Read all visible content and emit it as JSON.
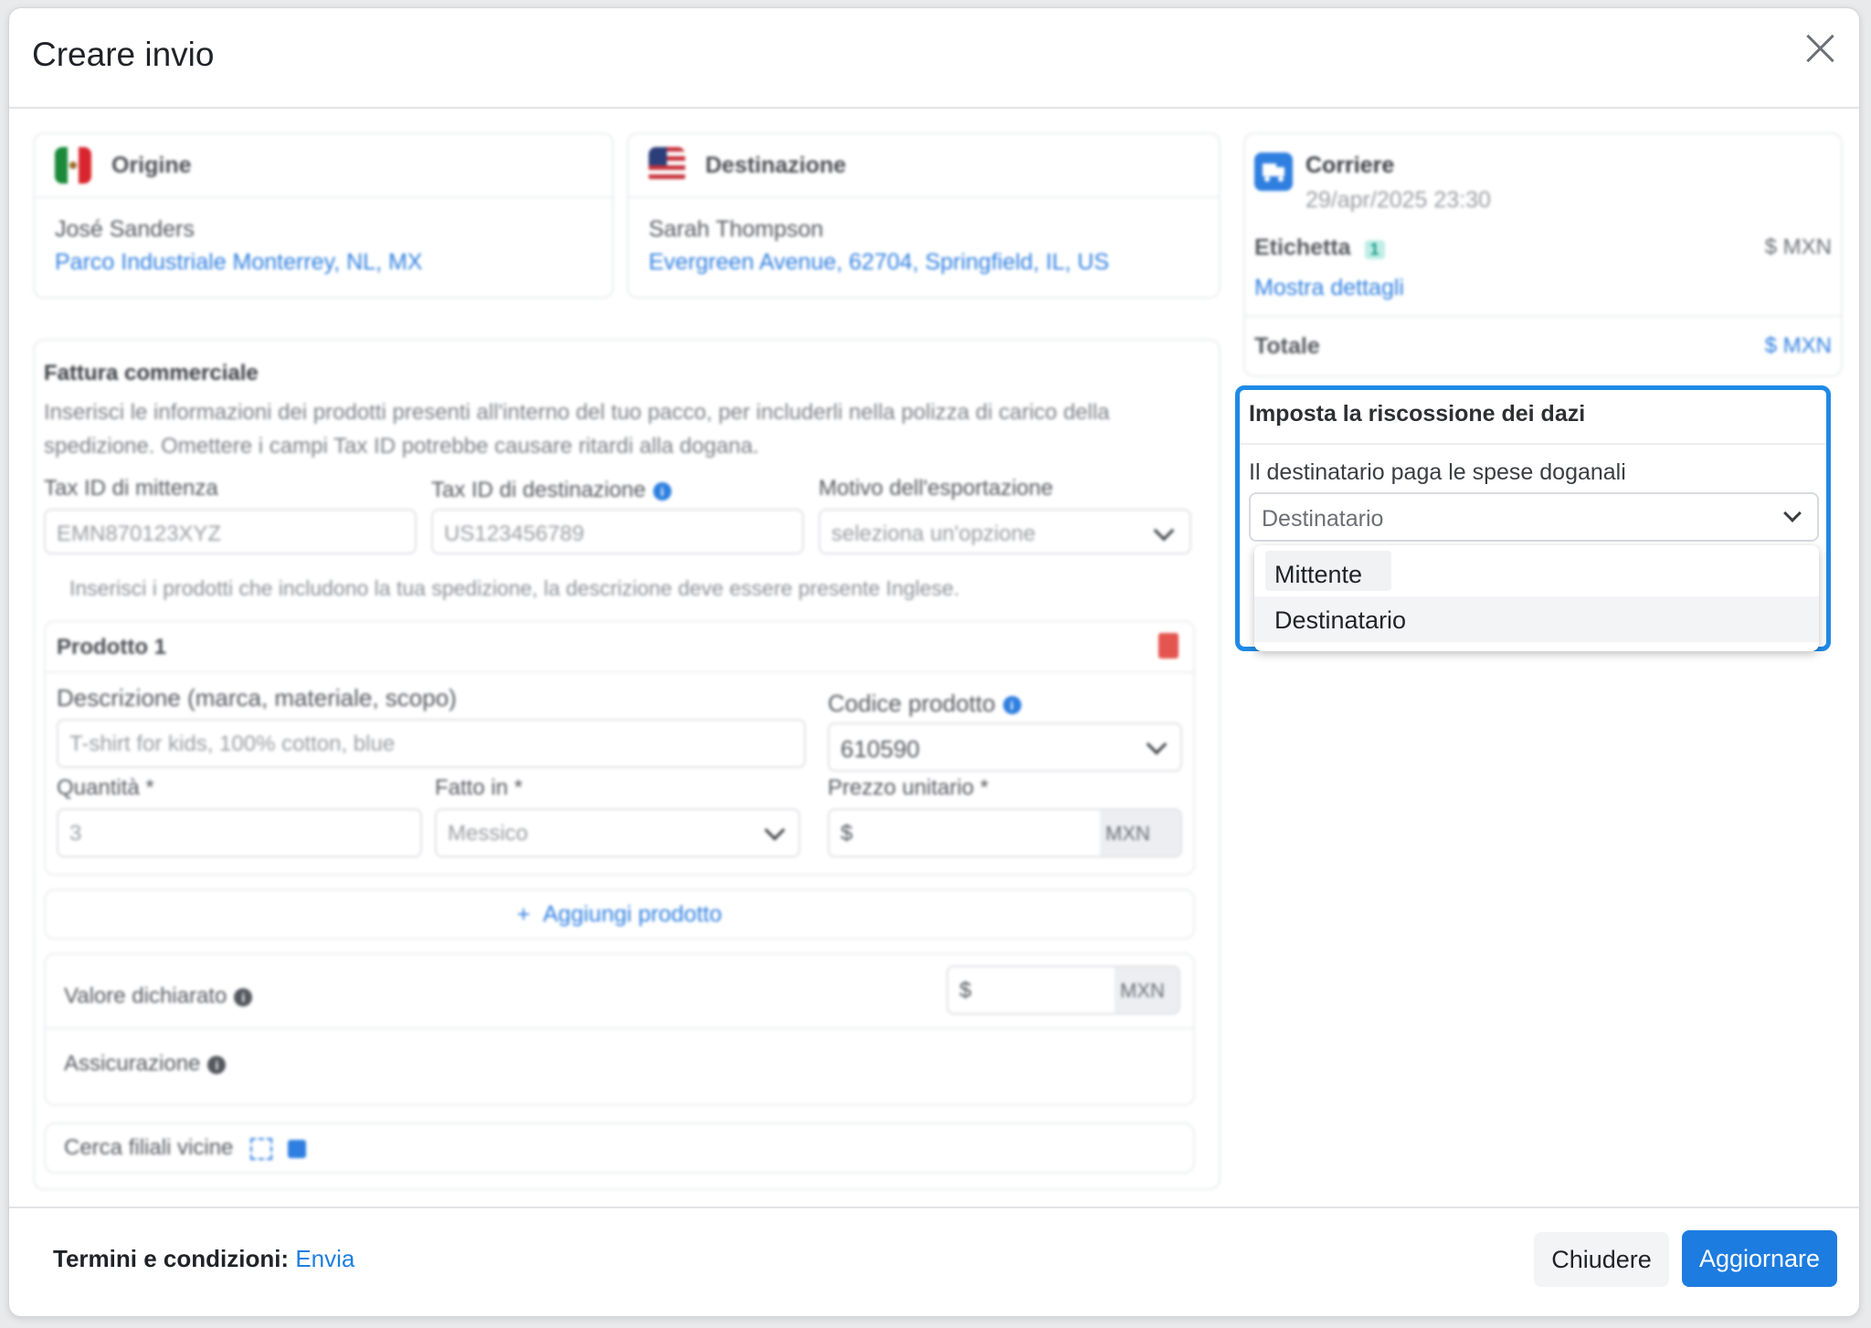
{
  "modal": {
    "title": "Creare invio"
  },
  "origin": {
    "title": "Origine",
    "name": "José Sanders",
    "address": "Parco Industriale Monterrey, NL, MX"
  },
  "destination": {
    "title": "Destinazione",
    "name": "Sarah Thompson",
    "address": "Evergreen Avenue, 62704, Springfield, IL, US"
  },
  "invoice": {
    "title": "Fattura commerciale",
    "description": "Inserisci le informazioni dei prodotti presenti all'interno del tuo pacco, per includerli nella polizza di carico della spedizione. Omettere i campi Tax ID potrebbe causare ritardi alla dogana.",
    "sender_tax_label": "Tax ID di mittenza",
    "sender_tax_value": "EMN870123XYZ",
    "dest_tax_label": "Tax ID di destinazione",
    "dest_tax_value": "US123456789",
    "export_reason_label": "Motivo dell'esportazione",
    "export_reason_placeholder": "seleziona un'opzione",
    "products_hint": "Inserisci i prodotti che includono la tua spedizione, la descrizione deve essere presente Inglese.",
    "product": {
      "title": "Prodotto 1",
      "description_label": "Descrizione (marca, materiale, scopo)",
      "description_placeholder": "T-shirt for kids, 100% cotton, blue",
      "code_label": "Codice prodotto",
      "code_value": "610590",
      "quantity_label": "Quantità *",
      "quantity_value": "3",
      "made_in_label": "Fatto in *",
      "made_in_value": "Messico",
      "unit_price_label": "Prezzo unitario *",
      "unit_price_prefix": "$",
      "currency": "MXN"
    },
    "add_product": "Aggiungi prodotto",
    "declared_value_label": "Valore dichiarato",
    "declared_prefix": "$",
    "declared_currency": "MXN",
    "insurance_label": "Assicurazione",
    "branches_label": "Cerca filiali vicine"
  },
  "carrier": {
    "title": "Corriere",
    "date": "29/apr/2025 23:30",
    "label_title": "Etichetta",
    "label_badge": "1",
    "label_amount": "$ MXN",
    "details_link": "Mostra dettagli",
    "total_label": "Totale",
    "total_amount": "$ MXN"
  },
  "duties": {
    "title": "Imposta la riscossione dei dazi",
    "field_label": "Il destinatario paga le spese doganali",
    "selected": "Destinatario",
    "options": [
      "Mittente",
      "Destinatario"
    ]
  },
  "footer": {
    "terms_label": "Termini e condizioni:",
    "terms_link": "Envia",
    "close_button": "Chiudere",
    "update_button": "Aggiornare"
  },
  "colors": {
    "accent": "#1d7ce0",
    "link": "#2f7fe0",
    "danger": "#e5554f"
  }
}
